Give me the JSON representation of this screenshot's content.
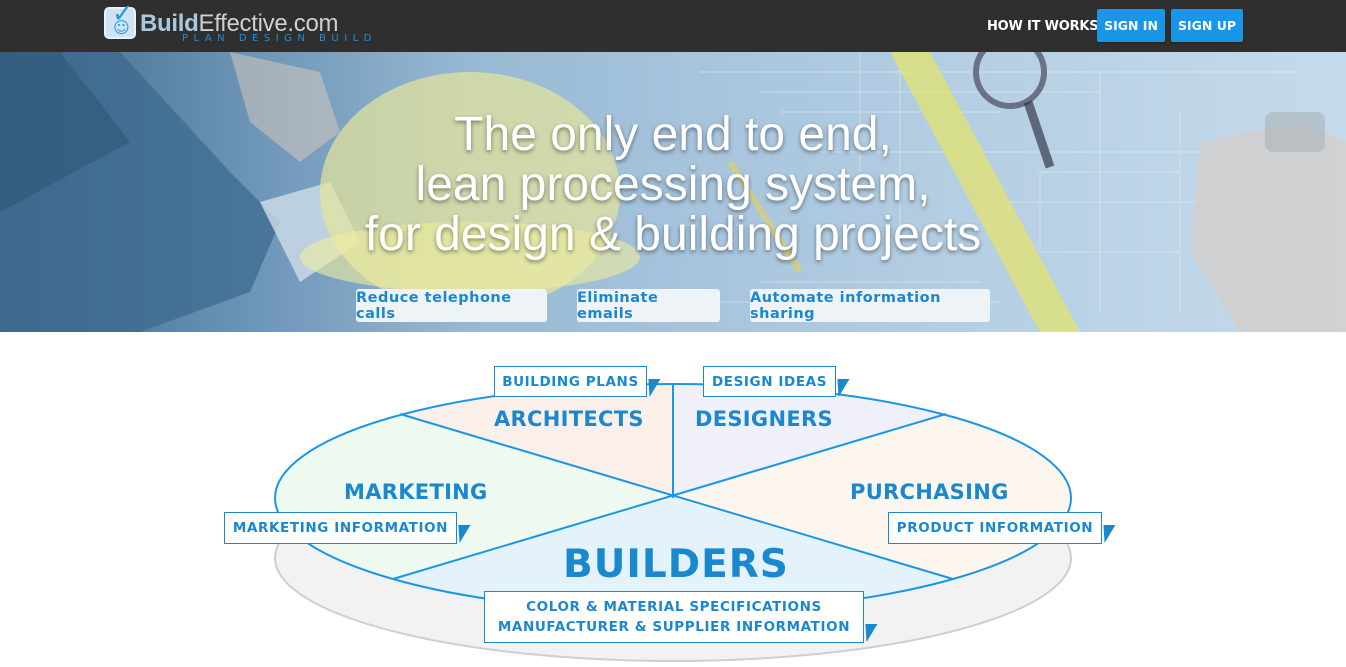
{
  "header": {
    "logo_bold": "Build",
    "logo_rest": "Effective.com",
    "logo_tagline": "PLAN DESIGN BUILD",
    "nav_how": "HOW IT WORKS?",
    "signin_label": "SIGN IN",
    "signup_label": "SIGN UP"
  },
  "hero": {
    "headline": [
      "The only end to end,",
      "lean processing system,",
      "for design & building projects"
    ],
    "pills": [
      "Reduce telephone calls",
      "Eliminate emails",
      "Automate information sharing"
    ]
  },
  "diagram": {
    "sectors": {
      "architects": "ARCHITECTS",
      "designers": "DESIGNERS",
      "marketing": "MARKETING",
      "purchasing": "PURCHASING",
      "builders": "BUILDERS"
    },
    "tags": {
      "building_plans": "BUILDING PLANS",
      "design_ideas": "DESIGN IDEAS",
      "marketing_information": "MARKETING INFORMATION",
      "product_information": "PRODUCT INFORMATION",
      "specs_line1": "COLOR & MATERIAL SPECIFICATIONS",
      "specs_line2": "MANUFACTURER & SUPPLIER INFORMATION"
    }
  },
  "colors": {
    "accent": "#1a96e8",
    "text_blue": "#1a88cf",
    "topbar": "#2f2f2f"
  },
  "icons": [
    "logo-checkbox-icon",
    "smiley-icon"
  ]
}
